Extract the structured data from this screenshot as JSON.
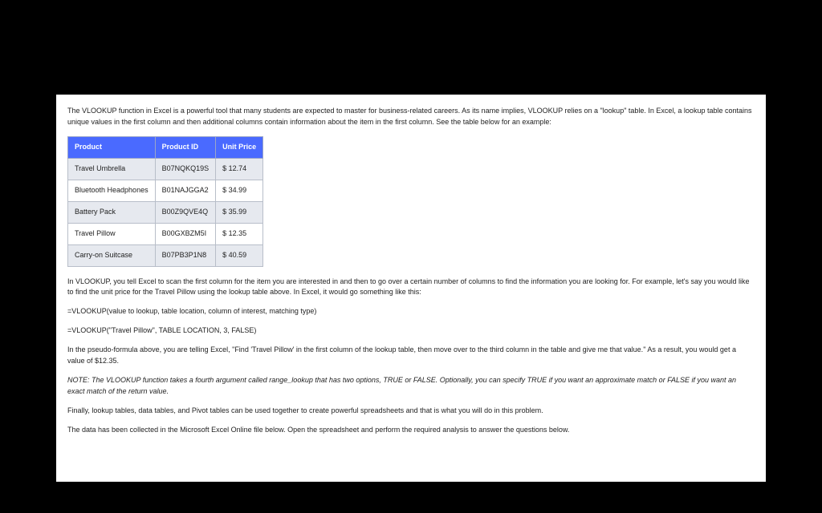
{
  "intro": "The VLOOKUP function in Excel is a powerful tool that many students are expected to master for business-related careers. As its name implies, VLOOKUP relies on a \"lookup\" table. In Excel, a lookup table contains unique values in the first column and then additional columns contain information about the item in the first column. See the table below for an example:",
  "table": {
    "headers": [
      "Product",
      "Product ID",
      "Unit Price"
    ],
    "rows": [
      {
        "product": "Travel Umbrella",
        "id": "B07NQKQ19S",
        "price": "$ 12.74"
      },
      {
        "product": "Bluetooth Headphones",
        "id": "B01NAJGGA2",
        "price": "$ 34.99"
      },
      {
        "product": "Battery Pack",
        "id": "B00Z9QVE4Q",
        "price": "$ 35.99"
      },
      {
        "product": "Travel Pillow",
        "id": "B00GXBZM5I",
        "price": "$ 12.35"
      },
      {
        "product": "Carry-on Suitcase",
        "id": "B07PB3P1N8",
        "price": "$ 40.59"
      }
    ]
  },
  "explain": "In VLOOKUP, you tell Excel to scan the first column for the item you are interested in and then to go over a certain number of columns to find the information you are looking for. For example, let's say you would like to find the unit price for the Travel Pillow using the lookup table above. In Excel, it would go something like this:",
  "formula_generic": "=VLOOKUP(value to lookup, table location, column of interest, matching type)",
  "formula_example": "=VLOOKUP(\"Travel Pillow\", TABLE LOCATION, 3, FALSE)",
  "pseudo": "In the pseudo-formula above, you are telling Excel, \"Find 'Travel Pillow' in the first column of the lookup table, then move over to the third column in the table and give me that value.\" As a result, you would get a value of $12.35.",
  "note": "NOTE: The VLOOKUP function takes a fourth argument called range_lookup that has two options, TRUE or FALSE. Optionally, you can specify TRUE if you want an approximate match or FALSE if you want an exact match of the return value.",
  "closing1": "Finally, lookup tables, data tables, and Pivot tables can be used together to create powerful spreadsheets and that is what you will do in this problem.",
  "closing2": "The data has been collected in the Microsoft Excel Online file below. Open the spreadsheet and perform the required analysis to answer the questions below."
}
